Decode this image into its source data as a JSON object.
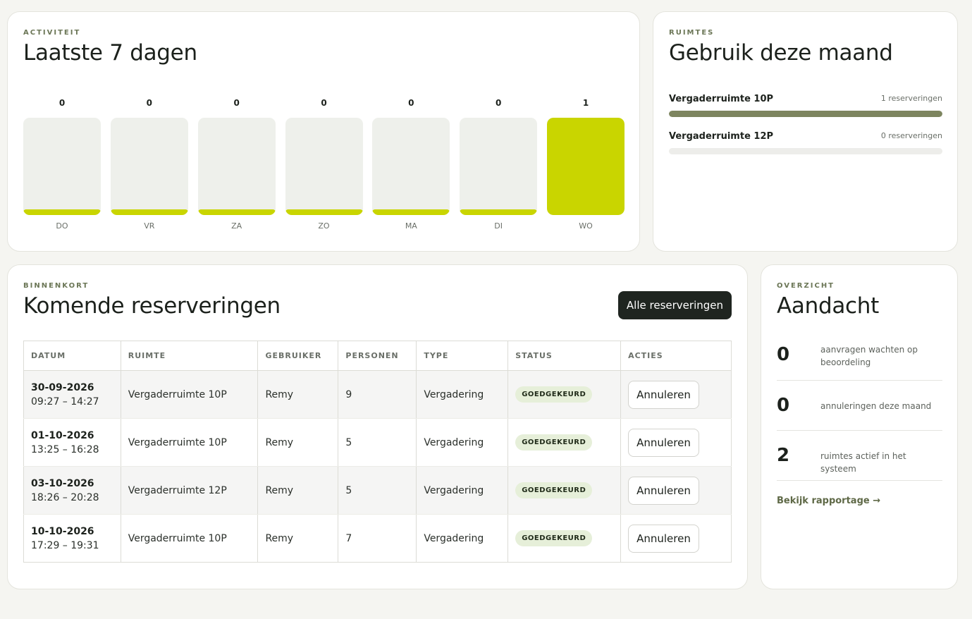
{
  "activity": {
    "eyebrow": "ACTIVITEIT",
    "title": "Laatste 7 dagen",
    "accent_color": "#c9d500",
    "days": [
      {
        "label": "DO",
        "count": "0",
        "value": 0
      },
      {
        "label": "VR",
        "count": "0",
        "value": 0
      },
      {
        "label": "ZA",
        "count": "0",
        "value": 0
      },
      {
        "label": "ZO",
        "count": "0",
        "value": 0
      },
      {
        "label": "MA",
        "count": "0",
        "value": 0
      },
      {
        "label": "DI",
        "count": "0",
        "value": 0
      },
      {
        "label": "WO",
        "count": "1",
        "value": 1
      }
    ]
  },
  "rooms": {
    "eyebrow": "RUIMTES",
    "title": "Gebruik deze maand",
    "items": [
      {
        "name": "Vergaderruimte 10P",
        "count_label": "1 reserveringen",
        "usage_fraction": 1
      },
      {
        "name": "Vergaderruimte 12P",
        "count_label": "0 reserveringen",
        "usage_fraction": 0
      }
    ]
  },
  "reservations": {
    "eyebrow": "BINNENKORT",
    "title": "Komende reserveringen",
    "all_button": "Alle reserveringen",
    "columns": [
      "DATUM",
      "RUIMTE",
      "GEBRUIKER",
      "PERSONEN",
      "TYPE",
      "STATUS",
      "ACTIES"
    ],
    "rows": [
      {
        "date": "30-09-2026",
        "time": "09:27 – 14:27",
        "room": "Vergaderruimte 10P",
        "user": "Remy",
        "persons": "9",
        "type": "Vergadering",
        "status": "GOEDGEKEURD",
        "action": "Annuleren"
      },
      {
        "date": "01-10-2026",
        "time": "13:25 – 16:28",
        "room": "Vergaderruimte 10P",
        "user": "Remy",
        "persons": "5",
        "type": "Vergadering",
        "status": "GOEDGEKEURD",
        "action": "Annuleren"
      },
      {
        "date": "03-10-2026",
        "time": "18:26 – 20:28",
        "room": "Vergaderruimte 12P",
        "user": "Remy",
        "persons": "5",
        "type": "Vergadering",
        "status": "GOEDGEKEURD",
        "action": "Annuleren"
      },
      {
        "date": "10-10-2026",
        "time": "17:29 – 19:31",
        "room": "Vergaderruimte 10P",
        "user": "Remy",
        "persons": "7",
        "type": "Vergadering",
        "status": "GOEDGEKEURD",
        "action": "Annuleren"
      }
    ]
  },
  "attention": {
    "eyebrow": "OVERZICHT",
    "title": "Aandacht",
    "items": [
      {
        "value": "0",
        "text": "aanvragen wachten op beoordeling"
      },
      {
        "value": "0",
        "text": "annuleringen deze maand"
      },
      {
        "value": "2",
        "text": "ruimtes actief in het systeem"
      }
    ],
    "link": "Bekijk rapportage →"
  }
}
